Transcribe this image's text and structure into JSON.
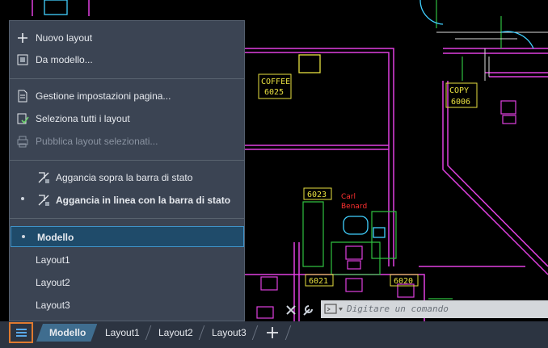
{
  "menu": {
    "items": [
      {
        "label": "Nuovo layout",
        "icon": "plus-icon"
      },
      {
        "label": "Da modello...",
        "icon": "template-icon"
      },
      {
        "label": "Gestione impostazioni pagina...",
        "icon": "page-setup-icon"
      },
      {
        "label": "Seleziona tutti i layout",
        "icon": "select-layouts-icon"
      },
      {
        "label": "Pubblica layout selezionati...",
        "icon": "printer-icon",
        "disabled": true
      },
      {
        "label": "Aggancia sopra la barra di stato",
        "icon": "dock-icon"
      },
      {
        "label": "Aggancia in linea con la barra di stato",
        "icon": "dock-icon",
        "checked": true
      },
      {
        "label": "Modello",
        "checked": true,
        "selected": true
      },
      {
        "label": "Layout1"
      },
      {
        "label": "Layout2"
      },
      {
        "label": "Layout3"
      }
    ]
  },
  "tabs": [
    "Modello",
    "Layout1",
    "Layout2",
    "Layout3"
  ],
  "active_tab": "Modello",
  "add_tab_icon": "plus-icon",
  "command_line": {
    "placeholder": "Digitare un comando"
  },
  "drawing_labels": {
    "coffee_name": "COFFEE",
    "coffee_num": "6025",
    "copy_name": "COPY",
    "copy_num": "6006",
    "room_6023": "6023",
    "room_6021": "6021",
    "room_6020": "6020",
    "person_first": "Carl",
    "person_last": "Benard"
  },
  "colors": {
    "accent": "#e07a2f",
    "active_tab": "#3f6d8f",
    "menu_bg": "#3b4453"
  }
}
